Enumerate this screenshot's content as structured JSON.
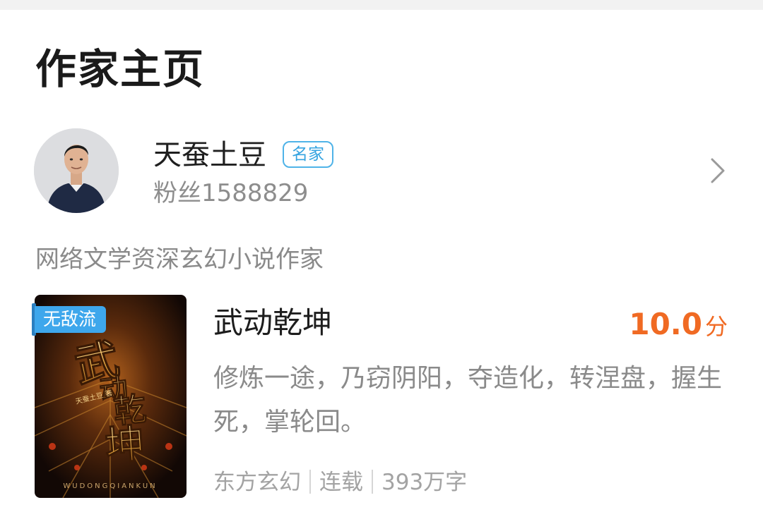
{
  "header": {
    "title": "作家主页"
  },
  "author": {
    "name": "天蚕土豆",
    "badge": "名家",
    "fans": "粉丝1588829",
    "avatar_icon": "author-avatar",
    "more_icon": "chevron-right-icon"
  },
  "bio": "网络文学资深玄幻小说作家",
  "book": {
    "genre_tag": "无敌流",
    "title": "武动乾坤",
    "rating": "10.0",
    "rating_unit": "分",
    "description": "修炼一途，乃窃阴阳，夺造化，转涅盘，握生死，掌轮回。",
    "category": "东方玄幻",
    "status": "连载",
    "word_count": "393万字",
    "cover_title": "武动乾坤",
    "cover_subtitle": "WUDONGQIANKUN"
  },
  "colors": {
    "accent_blue": "#3ea7ec",
    "rating_orange": "#f06a23"
  }
}
